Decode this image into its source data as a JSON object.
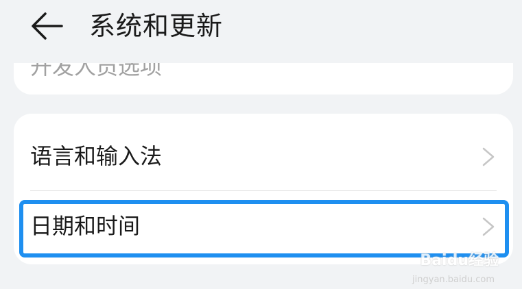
{
  "header": {
    "back_icon": "arrow-left-icon",
    "title": "系统和更新"
  },
  "top_card": {
    "clipped_text": "开发人员选项"
  },
  "settings": {
    "items": [
      {
        "label": "语言和输入法",
        "icon": "chevron-right-icon"
      },
      {
        "label": "日期和时间",
        "icon": "chevron-right-icon"
      }
    ]
  },
  "highlight": {
    "color": "#1e8ff0"
  },
  "watermark": {
    "brand": "Baidu经验",
    "url": "jingyan.baidu.com"
  },
  "colors": {
    "background": "#f1f3f5",
    "card": "#ffffff",
    "text": "#1a1a1a",
    "chevron": "#c6c6c6"
  }
}
